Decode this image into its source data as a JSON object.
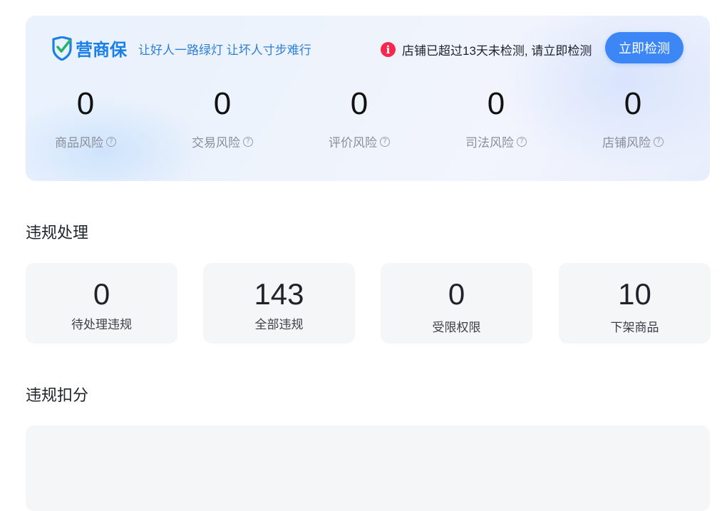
{
  "brand": {
    "name": "营商保",
    "slogan": "让好人一路绿灯 让坏人寸步难行",
    "color": "#1a7fe6"
  },
  "alert": {
    "icon": "info-icon",
    "message": "店铺已超过13天未检测, 请立即检测",
    "color": "#f5284e"
  },
  "check_button": {
    "label": "立即检测",
    "color": "#3c87f5"
  },
  "risks": [
    {
      "value": "0",
      "label": "商品风险"
    },
    {
      "value": "0",
      "label": "交易风险"
    },
    {
      "value": "0",
      "label": "评价风险"
    },
    {
      "value": "0",
      "label": "司法风险"
    },
    {
      "value": "0",
      "label": "店铺风险"
    }
  ],
  "violation_handling": {
    "title": "违规处理",
    "cards": [
      {
        "value": "0",
        "label": "待处理违规"
      },
      {
        "value": "143",
        "label": "全部违规"
      },
      {
        "value": "0",
        "label": "受限权限"
      },
      {
        "value": "10",
        "label": "下架商品"
      }
    ]
  },
  "violation_deduction": {
    "title": "违规扣分"
  }
}
